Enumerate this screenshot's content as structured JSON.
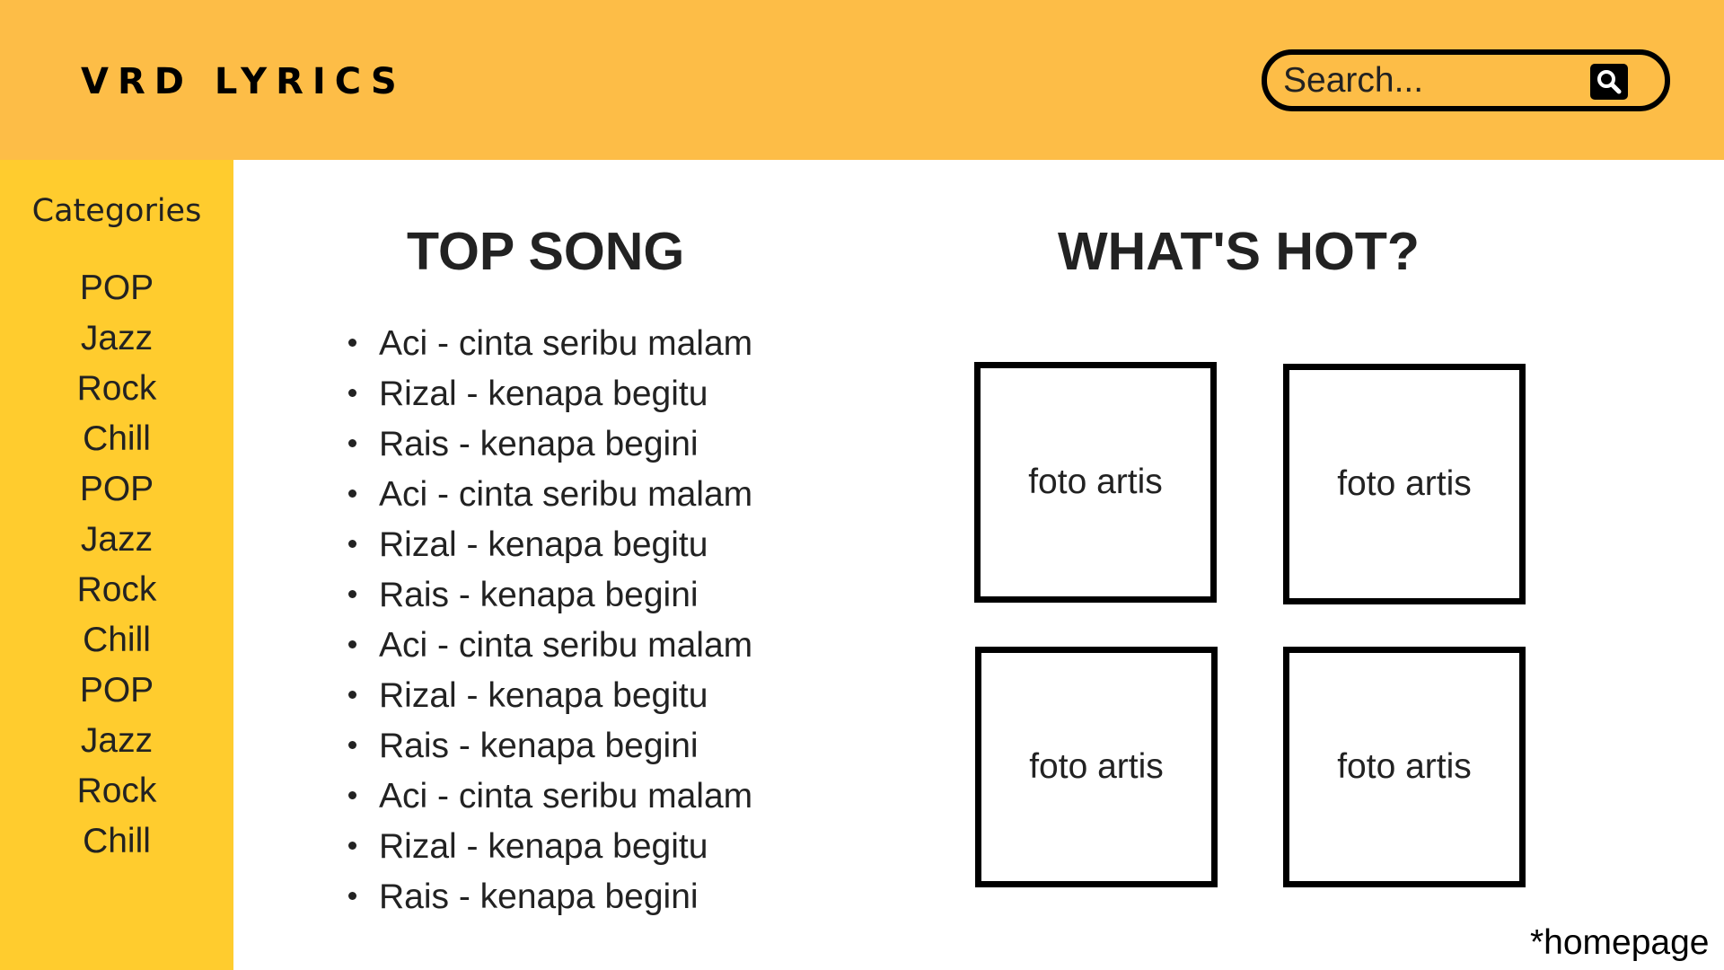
{
  "header": {
    "logo": "VRD LYRICS",
    "search": {
      "placeholder": "Search..."
    }
  },
  "sidebar": {
    "title": "Categories",
    "items": [
      "POP",
      "Jazz",
      "Rock",
      "Chill",
      "POP",
      "Jazz",
      "Rock",
      "Chill",
      "POP",
      "Jazz",
      "Rock",
      "Chill"
    ]
  },
  "top_song": {
    "title": "TOP SONG",
    "songs": [
      "Aci - cinta seribu malam",
      "Rizal - kenapa begitu",
      "Rais - kenapa begini",
      "Aci - cinta seribu malam",
      "Rizal - kenapa begitu",
      "Rais - kenapa begini",
      "Aci - cinta seribu malam",
      "Rizal - kenapa begitu",
      "Rais - kenapa begini",
      "Aci - cinta seribu malam",
      "Rizal - kenapa begitu",
      "Rais - kenapa begini"
    ]
  },
  "whats_hot": {
    "title": "WHAT'S HOT?",
    "cards": [
      "foto artis",
      "foto artis",
      "foto artis",
      "foto artis"
    ]
  },
  "footer_note": "*homepage",
  "icons": {
    "search": "search-icon"
  },
  "colors": {
    "header": "#FDBD47",
    "sidebar": "#FFCC2E",
    "text": "#222222"
  }
}
